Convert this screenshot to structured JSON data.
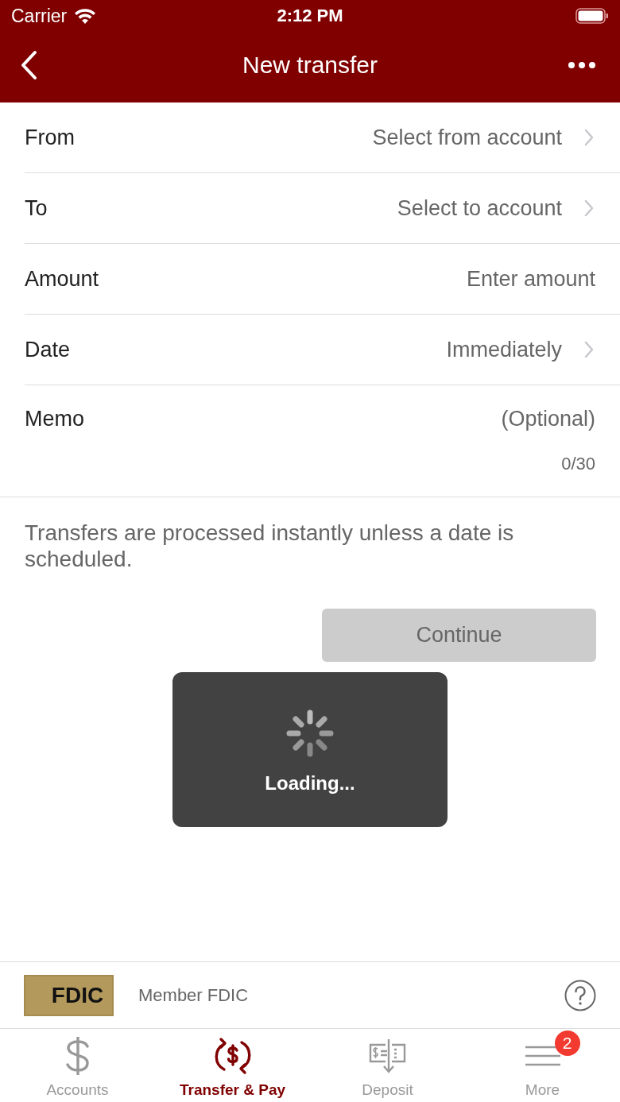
{
  "status_bar": {
    "carrier": "Carrier",
    "time": "2:12 PM"
  },
  "nav_bar": {
    "title": "New transfer"
  },
  "form": [
    {
      "kind": "select",
      "label": "From",
      "value": "Select from account"
    },
    {
      "kind": "select",
      "label": "To",
      "value": "Select to account"
    },
    {
      "kind": "input",
      "label": "Amount",
      "placeholder": "Enter amount"
    },
    {
      "kind": "select",
      "label": "Date",
      "value": "Immediately"
    },
    {
      "kind": "memo",
      "label": "Memo",
      "placeholder": "(Optional)",
      "counter": "0/30"
    }
  ],
  "notice": "Transfers are processed instantly unless a date is scheduled.",
  "continue_button": {
    "label": "Continue",
    "disabled": true
  },
  "loading": {
    "label": "Loading..."
  },
  "footer": {
    "logo": "FDIC",
    "text": "Member FDIC"
  },
  "tabs": [
    {
      "kind": "accounts",
      "label": "Accounts",
      "selected": false
    },
    {
      "kind": "transfer",
      "label": "Transfer & Pay",
      "selected": true
    },
    {
      "kind": "deposit",
      "label": "Deposit",
      "selected": false
    },
    {
      "kind": "more",
      "label": "More",
      "selected": false,
      "badge": "2"
    }
  ]
}
